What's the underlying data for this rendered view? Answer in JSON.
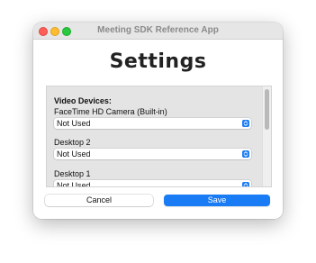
{
  "window": {
    "title": "Meeting SDK Reference App"
  },
  "heading": "Settings",
  "video_devices": {
    "section_title": "Video Devices:",
    "devices": [
      {
        "name": "FaceTime HD Camera (Built-in)",
        "selected": "Not Used"
      },
      {
        "name": "Desktop 2",
        "selected": "Not Used"
      },
      {
        "name": "Desktop 1",
        "selected": "Not Used"
      }
    ]
  },
  "buttons": {
    "cancel": "Cancel",
    "save": "Save"
  },
  "colors": {
    "accent": "#1a7cf5",
    "close": "#ff5f57",
    "minimize": "#febc2e",
    "maximize": "#28c840"
  },
  "icons": {
    "select_indicator": "up-down-chevron-icon"
  }
}
